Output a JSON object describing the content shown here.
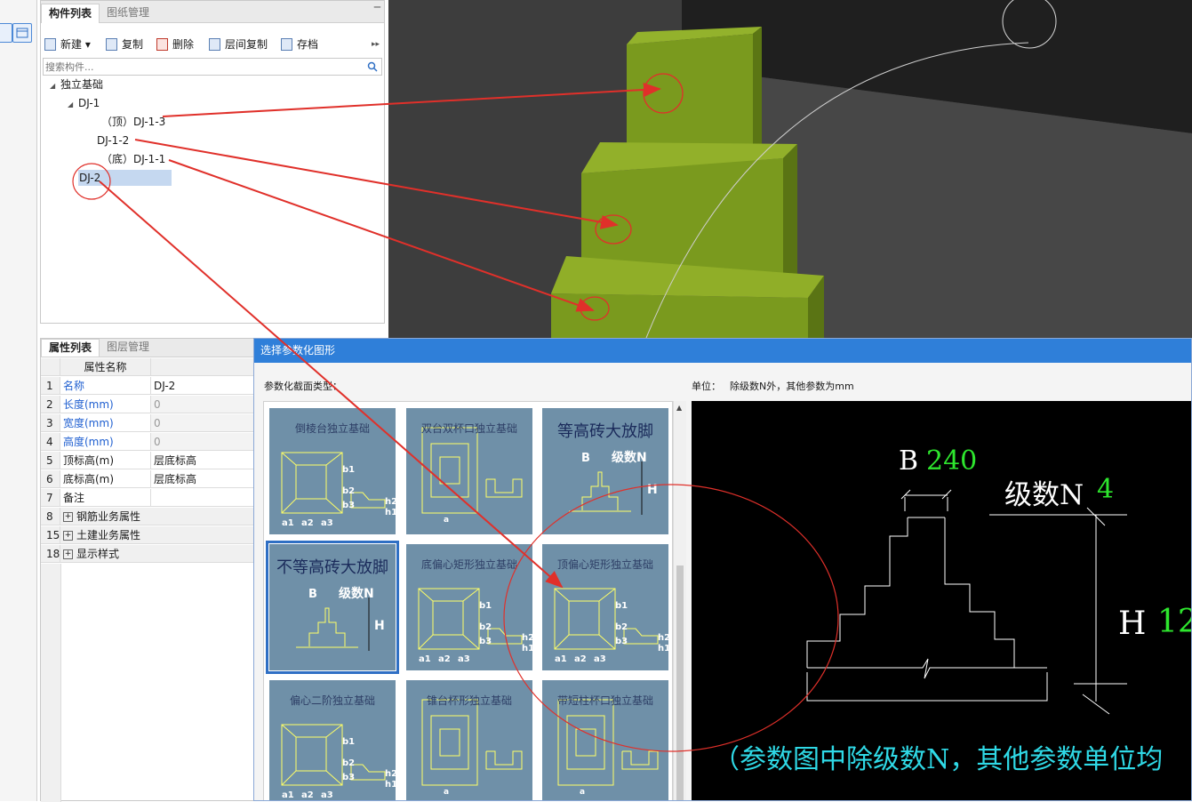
{
  "component_panel": {
    "tabs": [
      "构件列表",
      "图纸管理"
    ],
    "close_icon": "pin-icon",
    "toolbar": {
      "new_label": "新建",
      "copy_label": "复制",
      "delete_label": "删除",
      "floor_copy_label": "层间复制",
      "save_label": "存档",
      "more": "▸▸"
    },
    "search_placeholder": "搜索构件...",
    "tree": {
      "root": "独立基础",
      "dj1": "DJ-1",
      "dj13": "（顶）DJ-1-3",
      "dj12": "DJ-1-2",
      "dj11": "（底）DJ-1-1",
      "dj2": "DJ-2"
    }
  },
  "property_panel": {
    "tabs": [
      "属性列表",
      "图层管理"
    ],
    "headers": {
      "name": "属性名称",
      "value": "属性"
    },
    "rows": [
      {
        "num": "1",
        "name": "名称",
        "value": "DJ-2",
        "blue": true,
        "gray": false
      },
      {
        "num": "2",
        "name": "长度(mm)",
        "value": "0",
        "blue": true,
        "gray": true
      },
      {
        "num": "3",
        "name": "宽度(mm)",
        "value": "0",
        "blue": true,
        "gray": true
      },
      {
        "num": "4",
        "name": "高度(mm)",
        "value": "0",
        "blue": true,
        "gray": true
      },
      {
        "num": "5",
        "name": "顶标高(m)",
        "value": "层底标高",
        "blue": false,
        "gray": false
      },
      {
        "num": "6",
        "name": "底标高(m)",
        "value": "层底标高",
        "blue": false,
        "gray": false
      },
      {
        "num": "7",
        "name": "备注",
        "value": "",
        "blue": false,
        "gray": false
      },
      {
        "num": "8",
        "name": "钢筋业务属性",
        "value": "",
        "group": true
      },
      {
        "num": "15",
        "name": "土建业务属性",
        "value": "",
        "group": true
      },
      {
        "num": "18",
        "name": "显示样式",
        "value": "",
        "group": true
      }
    ]
  },
  "dialog": {
    "title": "选择参数化图形",
    "section_label": "参数化截面类型：",
    "unit_label": "单位：",
    "unit_text": "除级数N外，其他参数为mm",
    "thumbnails": [
      "倒棱台独立基础",
      "双台双杯口独立基础",
      "等高砖大放脚",
      "不等高砖大放脚",
      "底偏心矩形独立基础",
      "顶偏心矩形独立基础",
      "偏心二阶独立基础",
      "锥台杯形独立基础",
      "带短柱杯口独立基础"
    ],
    "thumb_labels": {
      "b": "B",
      "n": "级数N",
      "h": "H",
      "a1": "a1",
      "a2": "a2",
      "a3": "a3",
      "a": "a",
      "b1": "b1",
      "b2": "b2",
      "b3": "b3",
      "h1": "h1",
      "h2": "h2",
      "bb": "b"
    },
    "preview": {
      "b_label": "B",
      "b_value": "240",
      "n_label": "级数N",
      "n_value": "4",
      "h_label": "H",
      "h_value": "12",
      "note": "（参数图中除级数N，其他参数单位均"
    }
  },
  "colors": {
    "footing_green": "#7a9a1e",
    "annotation_red": "#e0302a",
    "preview_green": "#2ee62e",
    "note_cyan": "#2fd9e6"
  }
}
